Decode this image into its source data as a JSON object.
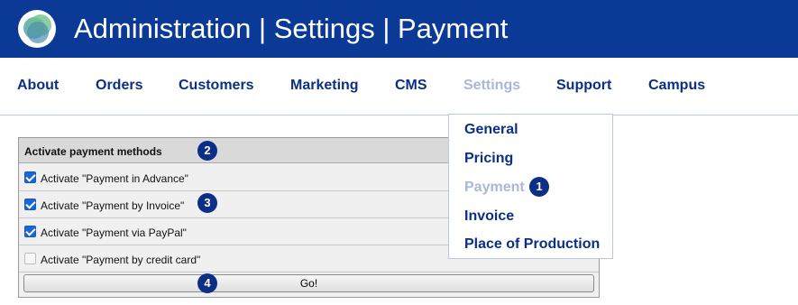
{
  "header": {
    "title": "Administration  | Settings | Payment"
  },
  "nav": {
    "items": [
      {
        "label": "About"
      },
      {
        "label": "Orders"
      },
      {
        "label": "Customers"
      },
      {
        "label": "Marketing"
      },
      {
        "label": "CMS"
      },
      {
        "label": "Settings",
        "active": true
      },
      {
        "label": "Support"
      },
      {
        "label": "Campus"
      }
    ]
  },
  "dropdown": {
    "items": [
      {
        "label": "General"
      },
      {
        "label": "Pricing"
      },
      {
        "label": "Payment",
        "active": true
      },
      {
        "label": "Invoice"
      },
      {
        "label": "Place of Production"
      }
    ]
  },
  "panel": {
    "title": "Activate payment methods",
    "rows": [
      {
        "label": "Activate \"Payment in Advance\"",
        "checked": true
      },
      {
        "label": "Activate \"Payment by Invoice\"",
        "checked": true
      },
      {
        "label": "Activate \"Payment via PayPal\"",
        "checked": true
      },
      {
        "label": "Activate \"Payment by credit card\"",
        "checked": false
      }
    ],
    "go_label": "Go!"
  },
  "badges": [
    "1",
    "2",
    "3",
    "4"
  ],
  "colors": {
    "header_bg": "#0b3a96",
    "nav_text": "#0b2f86",
    "active_text": "#a8b8d8",
    "checkbox": "#1a66d6"
  }
}
